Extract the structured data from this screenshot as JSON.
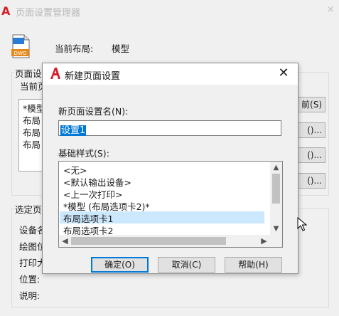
{
  "bg_window": {
    "title": "页面设置管理器",
    "current_layout_label": "当前布局:",
    "current_layout_value": "模型",
    "dwg_icon_text": "DWG",
    "groupbox1_label": "页面设",
    "current_page_label": "当前页",
    "list_items": [
      "*模型",
      "布局",
      "布局",
      "布局"
    ],
    "buttons": [
      "前(S)",
      "()...",
      "()...",
      "()..."
    ],
    "groupbox2_label": "选定页",
    "detail_labels": [
      "设备名",
      "绘图位",
      "打印大",
      "位置:",
      "说明:"
    ]
  },
  "dialog": {
    "title": "新建页面设置",
    "close_glyph": "✕",
    "name_label": "新页面设置名(N):",
    "name_value": "设置1",
    "base_label": "基础样式(S):",
    "base_list": [
      "<无>",
      "<默认输出设备>",
      "<上一次打印>",
      "*模型 (布局选项卡2)*",
      "布局选项卡1",
      "布局选项卡2"
    ],
    "selected_index": 4,
    "buttons": {
      "ok": "确定(O)",
      "cancel": "取消(C)",
      "help": "帮助(H)"
    }
  },
  "colors": {
    "accent": "#0078d7",
    "logo_red": "#d51e28"
  }
}
